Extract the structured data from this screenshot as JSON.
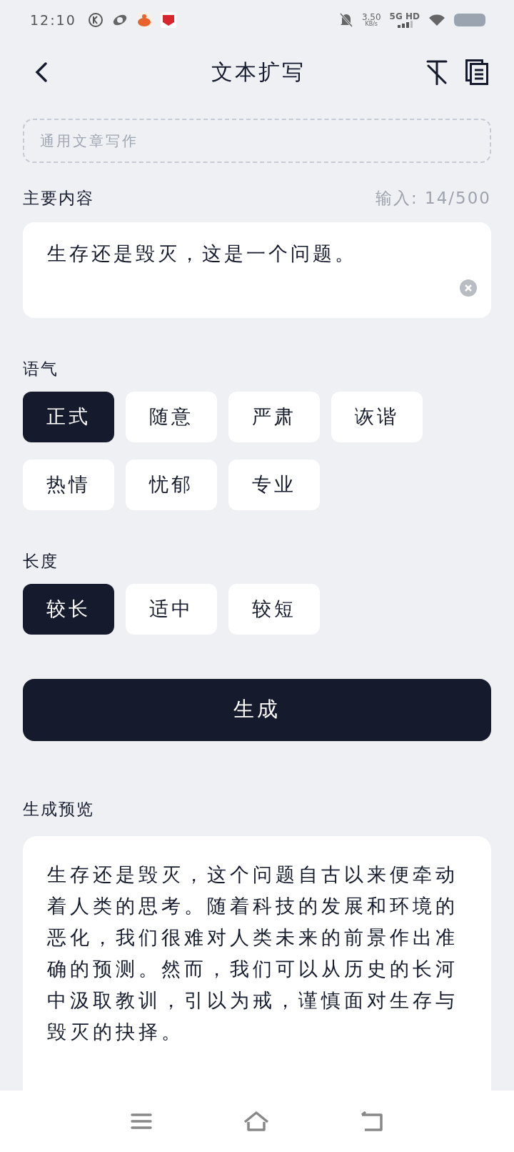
{
  "status_bar": {
    "time": "12:10",
    "speed_value": "3.50",
    "speed_unit": "KB/s",
    "network": "5G HD"
  },
  "header": {
    "title": "文本扩写"
  },
  "template_field": {
    "placeholder": "通用文章写作"
  },
  "content": {
    "label": "主要内容",
    "counter": "输入: 14/500",
    "value": "生存还是毁灭，这是一个问题。"
  },
  "tone": {
    "label": "语气",
    "options": [
      {
        "label": "正式",
        "selected": true
      },
      {
        "label": "随意",
        "selected": false
      },
      {
        "label": "严肃",
        "selected": false
      },
      {
        "label": "诙谐",
        "selected": false
      },
      {
        "label": "热情",
        "selected": false
      },
      {
        "label": "忧郁",
        "selected": false
      },
      {
        "label": "专业",
        "selected": false
      }
    ]
  },
  "length": {
    "label": "长度",
    "options": [
      {
        "label": "较长",
        "selected": true
      },
      {
        "label": "适中",
        "selected": false
      },
      {
        "label": "较短",
        "selected": false
      }
    ]
  },
  "generate_button": "生成",
  "preview": {
    "label": "生成预览",
    "text": "生存还是毁灭，这个问题自古以来便牵动着人类的思考。随着科技的发展和环境的恶化，我们很难对人类未来的前景作出准确的预测。然而，我们可以从历史的长河中汲取教训，引以为戒，谨慎面对生存与毁灭的抉择。"
  }
}
